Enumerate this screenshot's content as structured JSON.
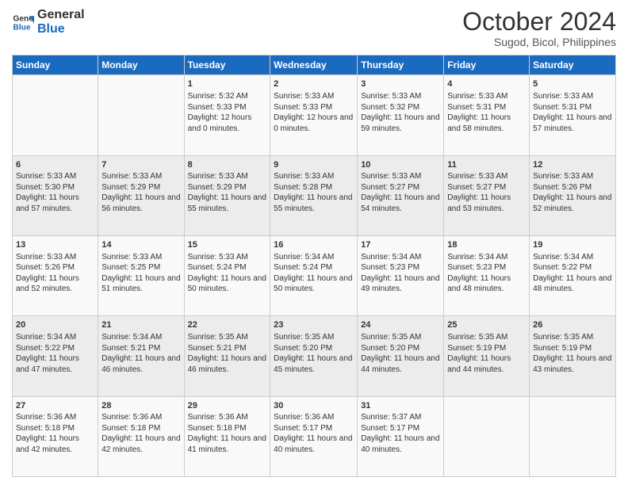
{
  "logo": {
    "line1": "General",
    "line2": "Blue"
  },
  "title": "October 2024",
  "location": "Sugod, Bicol, Philippines",
  "days_of_week": [
    "Sunday",
    "Monday",
    "Tuesday",
    "Wednesday",
    "Thursday",
    "Friday",
    "Saturday"
  ],
  "weeks": [
    [
      {
        "day": "",
        "sunrise": "",
        "sunset": "",
        "daylight": ""
      },
      {
        "day": "",
        "sunrise": "",
        "sunset": "",
        "daylight": ""
      },
      {
        "day": "1",
        "sunrise": "Sunrise: 5:32 AM",
        "sunset": "Sunset: 5:33 PM",
        "daylight": "Daylight: 12 hours and 0 minutes."
      },
      {
        "day": "2",
        "sunrise": "Sunrise: 5:33 AM",
        "sunset": "Sunset: 5:33 PM",
        "daylight": "Daylight: 12 hours and 0 minutes."
      },
      {
        "day": "3",
        "sunrise": "Sunrise: 5:33 AM",
        "sunset": "Sunset: 5:32 PM",
        "daylight": "Daylight: 11 hours and 59 minutes."
      },
      {
        "day": "4",
        "sunrise": "Sunrise: 5:33 AM",
        "sunset": "Sunset: 5:31 PM",
        "daylight": "Daylight: 11 hours and 58 minutes."
      },
      {
        "day": "5",
        "sunrise": "Sunrise: 5:33 AM",
        "sunset": "Sunset: 5:31 PM",
        "daylight": "Daylight: 11 hours and 57 minutes."
      }
    ],
    [
      {
        "day": "6",
        "sunrise": "Sunrise: 5:33 AM",
        "sunset": "Sunset: 5:30 PM",
        "daylight": "Daylight: 11 hours and 57 minutes."
      },
      {
        "day": "7",
        "sunrise": "Sunrise: 5:33 AM",
        "sunset": "Sunset: 5:29 PM",
        "daylight": "Daylight: 11 hours and 56 minutes."
      },
      {
        "day": "8",
        "sunrise": "Sunrise: 5:33 AM",
        "sunset": "Sunset: 5:29 PM",
        "daylight": "Daylight: 11 hours and 55 minutes."
      },
      {
        "day": "9",
        "sunrise": "Sunrise: 5:33 AM",
        "sunset": "Sunset: 5:28 PM",
        "daylight": "Daylight: 11 hours and 55 minutes."
      },
      {
        "day": "10",
        "sunrise": "Sunrise: 5:33 AM",
        "sunset": "Sunset: 5:27 PM",
        "daylight": "Daylight: 11 hours and 54 minutes."
      },
      {
        "day": "11",
        "sunrise": "Sunrise: 5:33 AM",
        "sunset": "Sunset: 5:27 PM",
        "daylight": "Daylight: 11 hours and 53 minutes."
      },
      {
        "day": "12",
        "sunrise": "Sunrise: 5:33 AM",
        "sunset": "Sunset: 5:26 PM",
        "daylight": "Daylight: 11 hours and 52 minutes."
      }
    ],
    [
      {
        "day": "13",
        "sunrise": "Sunrise: 5:33 AM",
        "sunset": "Sunset: 5:26 PM",
        "daylight": "Daylight: 11 hours and 52 minutes."
      },
      {
        "day": "14",
        "sunrise": "Sunrise: 5:33 AM",
        "sunset": "Sunset: 5:25 PM",
        "daylight": "Daylight: 11 hours and 51 minutes."
      },
      {
        "day": "15",
        "sunrise": "Sunrise: 5:33 AM",
        "sunset": "Sunset: 5:24 PM",
        "daylight": "Daylight: 11 hours and 50 minutes."
      },
      {
        "day": "16",
        "sunrise": "Sunrise: 5:34 AM",
        "sunset": "Sunset: 5:24 PM",
        "daylight": "Daylight: 11 hours and 50 minutes."
      },
      {
        "day": "17",
        "sunrise": "Sunrise: 5:34 AM",
        "sunset": "Sunset: 5:23 PM",
        "daylight": "Daylight: 11 hours and 49 minutes."
      },
      {
        "day": "18",
        "sunrise": "Sunrise: 5:34 AM",
        "sunset": "Sunset: 5:23 PM",
        "daylight": "Daylight: 11 hours and 48 minutes."
      },
      {
        "day": "19",
        "sunrise": "Sunrise: 5:34 AM",
        "sunset": "Sunset: 5:22 PM",
        "daylight": "Daylight: 11 hours and 48 minutes."
      }
    ],
    [
      {
        "day": "20",
        "sunrise": "Sunrise: 5:34 AM",
        "sunset": "Sunset: 5:22 PM",
        "daylight": "Daylight: 11 hours and 47 minutes."
      },
      {
        "day": "21",
        "sunrise": "Sunrise: 5:34 AM",
        "sunset": "Sunset: 5:21 PM",
        "daylight": "Daylight: 11 hours and 46 minutes."
      },
      {
        "day": "22",
        "sunrise": "Sunrise: 5:35 AM",
        "sunset": "Sunset: 5:21 PM",
        "daylight": "Daylight: 11 hours and 46 minutes."
      },
      {
        "day": "23",
        "sunrise": "Sunrise: 5:35 AM",
        "sunset": "Sunset: 5:20 PM",
        "daylight": "Daylight: 11 hours and 45 minutes."
      },
      {
        "day": "24",
        "sunrise": "Sunrise: 5:35 AM",
        "sunset": "Sunset: 5:20 PM",
        "daylight": "Daylight: 11 hours and 44 minutes."
      },
      {
        "day": "25",
        "sunrise": "Sunrise: 5:35 AM",
        "sunset": "Sunset: 5:19 PM",
        "daylight": "Daylight: 11 hours and 44 minutes."
      },
      {
        "day": "26",
        "sunrise": "Sunrise: 5:35 AM",
        "sunset": "Sunset: 5:19 PM",
        "daylight": "Daylight: 11 hours and 43 minutes."
      }
    ],
    [
      {
        "day": "27",
        "sunrise": "Sunrise: 5:36 AM",
        "sunset": "Sunset: 5:18 PM",
        "daylight": "Daylight: 11 hours and 42 minutes."
      },
      {
        "day": "28",
        "sunrise": "Sunrise: 5:36 AM",
        "sunset": "Sunset: 5:18 PM",
        "daylight": "Daylight: 11 hours and 42 minutes."
      },
      {
        "day": "29",
        "sunrise": "Sunrise: 5:36 AM",
        "sunset": "Sunset: 5:18 PM",
        "daylight": "Daylight: 11 hours and 41 minutes."
      },
      {
        "day": "30",
        "sunrise": "Sunrise: 5:36 AM",
        "sunset": "Sunset: 5:17 PM",
        "daylight": "Daylight: 11 hours and 40 minutes."
      },
      {
        "day": "31",
        "sunrise": "Sunrise: 5:37 AM",
        "sunset": "Sunset: 5:17 PM",
        "daylight": "Daylight: 11 hours and 40 minutes."
      },
      {
        "day": "",
        "sunrise": "",
        "sunset": "",
        "daylight": ""
      },
      {
        "day": "",
        "sunrise": "",
        "sunset": "",
        "daylight": ""
      }
    ]
  ]
}
